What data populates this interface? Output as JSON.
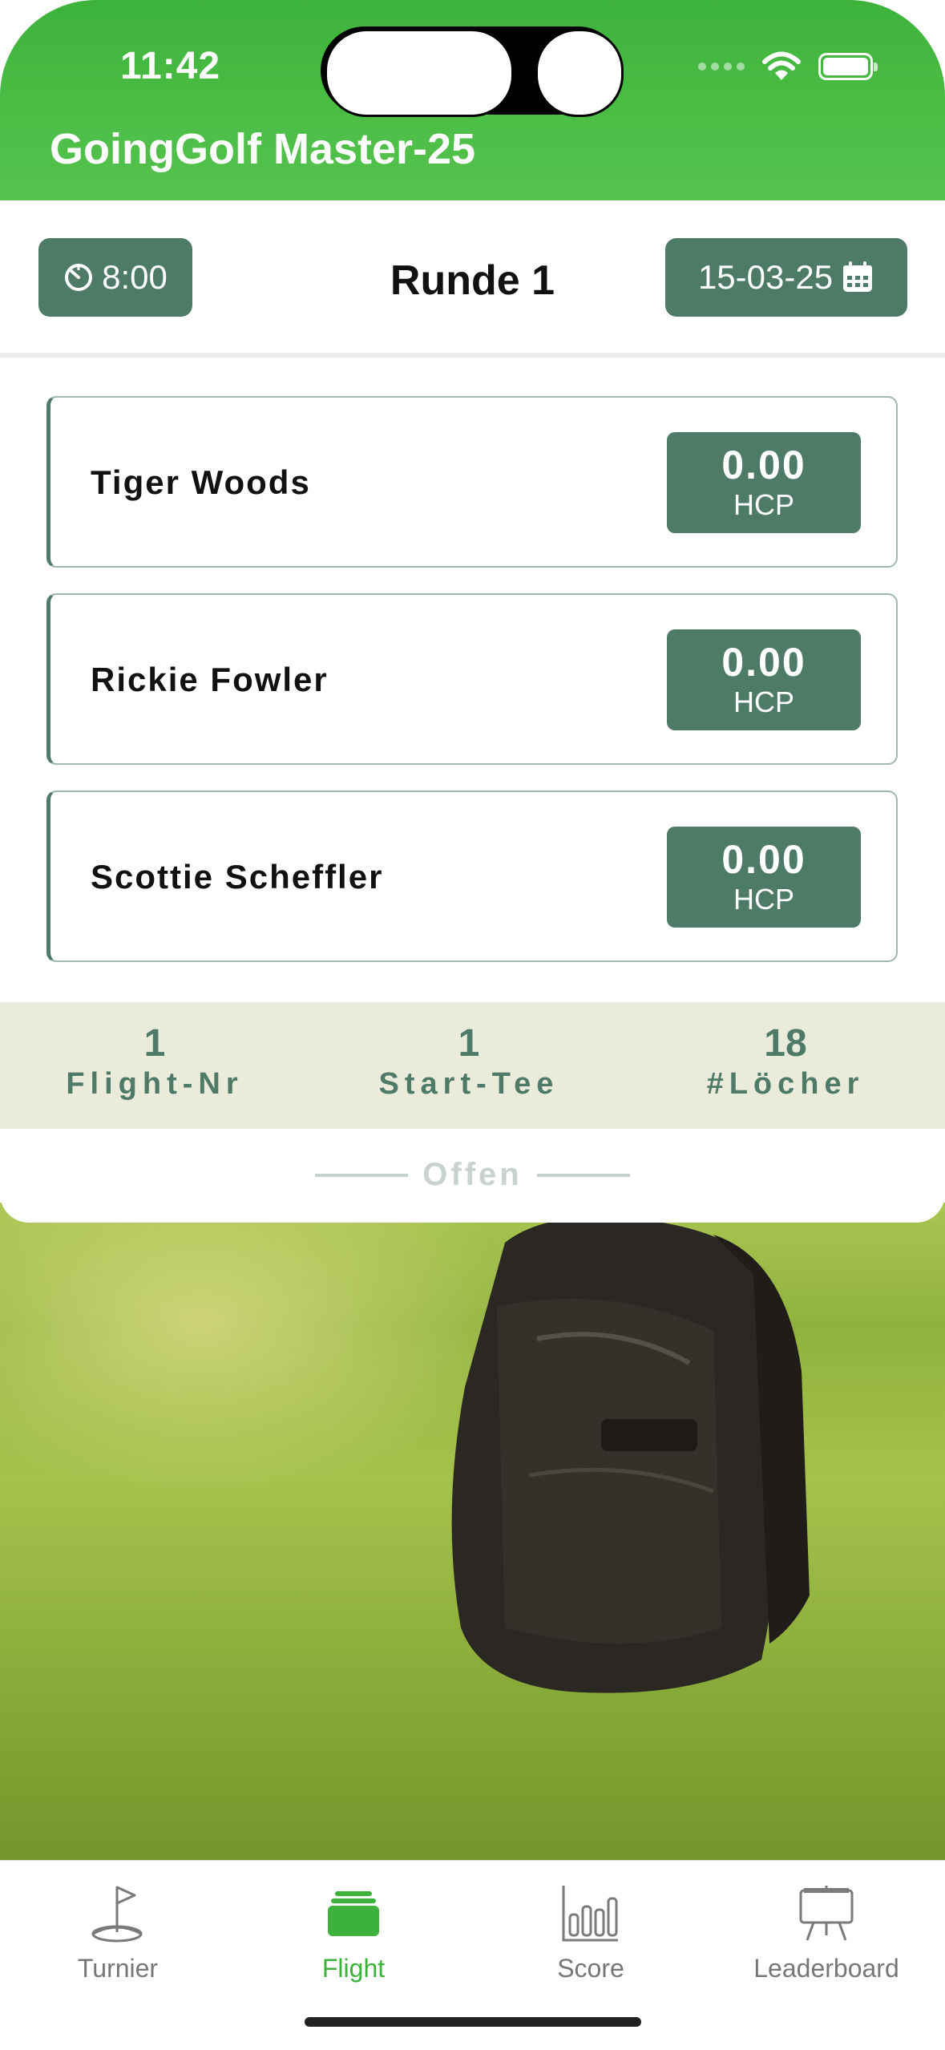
{
  "status_bar": {
    "time": "11:42"
  },
  "app": {
    "title": "GoingGolf Master-25"
  },
  "round": {
    "tee_time": "8:00",
    "title": "Runde 1",
    "date": "15-03-25"
  },
  "players": [
    {
      "name": "Tiger Woods",
      "hcp": "0.00",
      "hcp_label": "HCP"
    },
    {
      "name": "Rickie Fowler",
      "hcp": "0.00",
      "hcp_label": "HCP"
    },
    {
      "name": "Scottie Scheffler",
      "hcp": "0.00",
      "hcp_label": "HCP"
    }
  ],
  "stats": [
    {
      "value": "1",
      "label": "Flight-Nr"
    },
    {
      "value": "1",
      "label": "Start-Tee"
    },
    {
      "value": "18",
      "label": "#Löcher"
    }
  ],
  "flight_status": "Offen",
  "tabs": [
    {
      "label": "Turnier",
      "icon": "flag-icon",
      "active": false
    },
    {
      "label": "Flight",
      "icon": "stack-icon",
      "active": true
    },
    {
      "label": "Score",
      "icon": "bar-chart-icon",
      "active": false
    },
    {
      "label": "Leaderboard",
      "icon": "easel-icon",
      "active": false
    }
  ],
  "colors": {
    "header_green": "#3db23a",
    "accent": "#4e7a68",
    "stats_bg": "#ebebdc"
  }
}
